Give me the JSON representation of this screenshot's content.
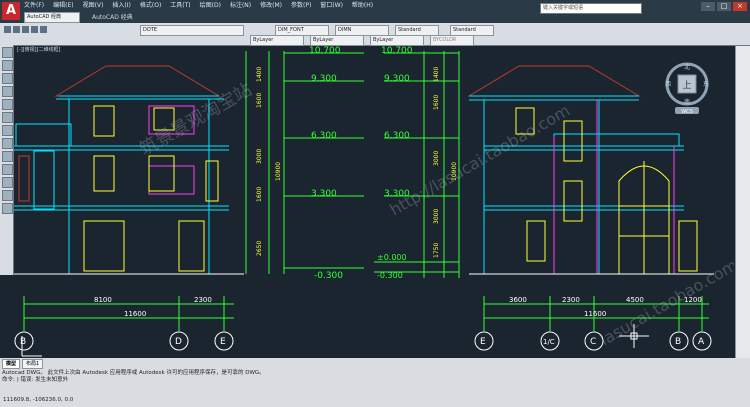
{
  "app": {
    "window_title": "AutoCAD 经典",
    "search_placeholder": "键入关键字或短语",
    "menu": [
      "文件(F)",
      "编辑(E)",
      "视图(V)",
      "插入(I)",
      "格式(O)",
      "工具(T)",
      "绘图(D)",
      "标注(N)",
      "修改(M)",
      "参数(P)",
      "窗口(W)",
      "帮助(H)"
    ]
  },
  "toolbar": {
    "workspace": "AutoCAD 经典",
    "layer": "DOTE",
    "text_style": "DIM_FONT",
    "dim_style": "DIMN",
    "table_style": "Standard",
    "multileader_style": "Standard",
    "color": "ByLayer",
    "linetype": "ByLayer",
    "lineweight": "ByLayer",
    "plotstyle": "BYCOLOR"
  },
  "viewport_label": "[-][俯视][二维线框]",
  "viewcube": {
    "north": "北",
    "south": "南",
    "east": "东",
    "west": "西",
    "top": "上",
    "wcs": "WCS"
  },
  "drawing": {
    "left_elevation": {
      "dims_bottom": [
        "8100",
        "2300"
      ],
      "total": "11600",
      "axes": [
        "B",
        "D",
        "E"
      ]
    },
    "right_elevation": {
      "dims_bottom": [
        "3600",
        "2300",
        "4500",
        "1200"
      ],
      "total": "11600",
      "axes": [
        "E",
        "1/C",
        "C",
        "B",
        "A"
      ]
    },
    "levels": [
      "10.700",
      "9.300",
      "6.300",
      "3.300",
      "±0.000",
      "-0.300"
    ],
    "left_heights": [
      "1400",
      "1600",
      "3000",
      "900",
      "1100",
      "1600",
      "3000",
      "500",
      "900",
      "1600",
      "3000",
      "2650",
      "150",
      "300"
    ],
    "right_heights": [
      "1400",
      "1600",
      "3000",
      "3000",
      "1750",
      "1250",
      "3000",
      "1250",
      "150",
      "300"
    ],
    "total_heights": [
      "10900",
      "10900"
    ],
    "watermarks": [
      "筑景景观淘宝站",
      "http://lasucai.taobao.com",
      "lasucai.taobao.com"
    ]
  },
  "layout_tabs": [
    "模型",
    "布局1"
  ],
  "command_lines": [
    "Autocad DWG。  此文件上次由 Autodesk 应用程序或 Autodesk 许可的应用程序保存，是可靠的 DWG。",
    "命令: ) 错误: 发生未知意外"
  ],
  "coordinates": "111609.8, -106236.0, 0.0"
}
